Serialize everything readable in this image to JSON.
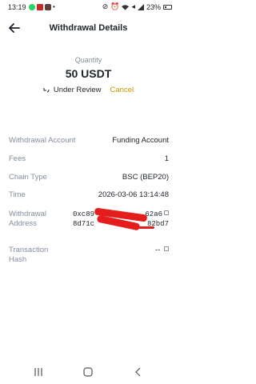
{
  "status_bar": {
    "time": "13:19",
    "battery": "23%",
    "notification_icons": [
      "whatsapp-icon",
      "flag-icon",
      "app-icon"
    ],
    "system_icons": [
      "silent-icon",
      "alarm-icon",
      "wifi-icon",
      "volume-icon",
      "signal-icon",
      "battery-icon"
    ]
  },
  "header": {
    "title": "Withdrawal Details"
  },
  "summary": {
    "quantity_label": "Quantity",
    "quantity_value": "50 USDT",
    "status": "Under Review",
    "cancel_label": "Cancel"
  },
  "details": {
    "withdrawal_account": {
      "label": "Withdrawal Account",
      "value": "Funding Account"
    },
    "fees": {
      "label": "Fees",
      "value": "1"
    },
    "chain_type": {
      "label": "Chain Type",
      "value": "BSC (BEP20)"
    },
    "time": {
      "label": "Time",
      "value": "2026-03-06 13:14:48"
    },
    "withdrawal_address": {
      "label_line1": "Withdrawal",
      "label_line2": "Address",
      "line1": "0xc89",
      "line1_tail": "62a6",
      "line2": "8d71c",
      "line2_tail": "82bd7"
    },
    "transaction_hash": {
      "label_line1": "Transaction",
      "label_line2": "Hash",
      "value": "--"
    }
  },
  "colors": {
    "accent": "#c99400",
    "label": "#848e9c",
    "text": "#1e2329",
    "redaction": "#e51d1d"
  }
}
